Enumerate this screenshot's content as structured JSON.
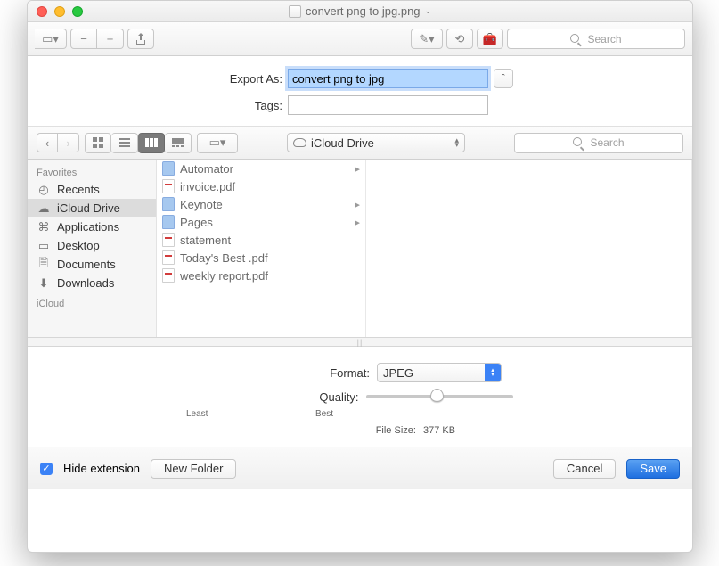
{
  "window": {
    "title": "convert png to jpg.png"
  },
  "toolbar": {
    "search_placeholder": "Search"
  },
  "export": {
    "label": "Export As:",
    "value": "convert png to jpg",
    "tags_label": "Tags:"
  },
  "browser": {
    "location": "iCloud Drive",
    "search_placeholder": "Search",
    "sidebar": {
      "section": "Favorites",
      "items": [
        {
          "label": "Recents",
          "icon": "clock",
          "selected": false
        },
        {
          "label": "iCloud Drive",
          "icon": "cloud",
          "selected": true
        },
        {
          "label": "Applications",
          "icon": "apps",
          "selected": false
        },
        {
          "label": "Desktop",
          "icon": "desktop",
          "selected": false
        },
        {
          "label": "Documents",
          "icon": "doc",
          "selected": false
        },
        {
          "label": "Downloads",
          "icon": "download",
          "selected": false
        }
      ],
      "section2": "iCloud"
    },
    "column": [
      {
        "name": "Automator",
        "type": "folder",
        "has_children": true
      },
      {
        "name": "invoice.pdf",
        "type": "pdf",
        "has_children": false
      },
      {
        "name": "Keynote",
        "type": "folder",
        "has_children": true
      },
      {
        "name": "Pages",
        "type": "folder",
        "has_children": true
      },
      {
        "name": "statement",
        "type": "pdf",
        "has_children": false
      },
      {
        "name": "Today's Best .pdf",
        "type": "pdf",
        "has_children": false
      },
      {
        "name": "weekly report.pdf",
        "type": "pdf",
        "has_children": false
      }
    ]
  },
  "format": {
    "format_label": "Format:",
    "format_value": "JPEG",
    "quality_label": "Quality:",
    "quality_least": "Least",
    "quality_best": "Best",
    "quality_position_pct": 48,
    "filesize_label": "File Size:",
    "filesize_value": "377 KB"
  },
  "bottom": {
    "hide_ext_label": "Hide extension",
    "hide_ext_checked": true,
    "new_folder": "New Folder",
    "cancel": "Cancel",
    "save": "Save"
  }
}
